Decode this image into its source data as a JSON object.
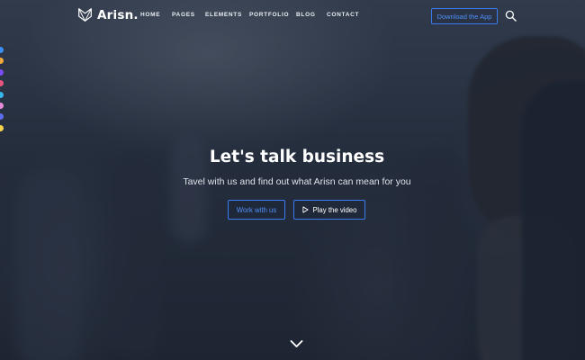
{
  "brand": {
    "name": "Arisn.",
    "logo_icon": "fox-logo-icon"
  },
  "nav": {
    "items": [
      {
        "label": "HOME"
      },
      {
        "label": "PAGES"
      },
      {
        "label": "ELEMENTS"
      },
      {
        "label": "PORTFOLIO"
      },
      {
        "label": "BLOG"
      },
      {
        "label": "CONTACT"
      }
    ],
    "download_label": "Download the App",
    "search_icon": "search-icon"
  },
  "hero": {
    "title": "Let's talk business",
    "subtitle": "Tavel with us and find out what Arisn can mean for you",
    "primary_button": "Work with us",
    "secondary_button": "Play the video",
    "play_icon": "play-icon",
    "scroll_icon": "chevron-down-icon"
  },
  "colors": {
    "accent": "#3a7cf0",
    "accent_text": "#4f8ff7",
    "swatches": [
      "#3a8ef6",
      "#f2a93b",
      "#7a4cf5",
      "#e8557e",
      "#35b7e9",
      "#e58ad6",
      "#5c6df2",
      "#f7d24a"
    ]
  }
}
